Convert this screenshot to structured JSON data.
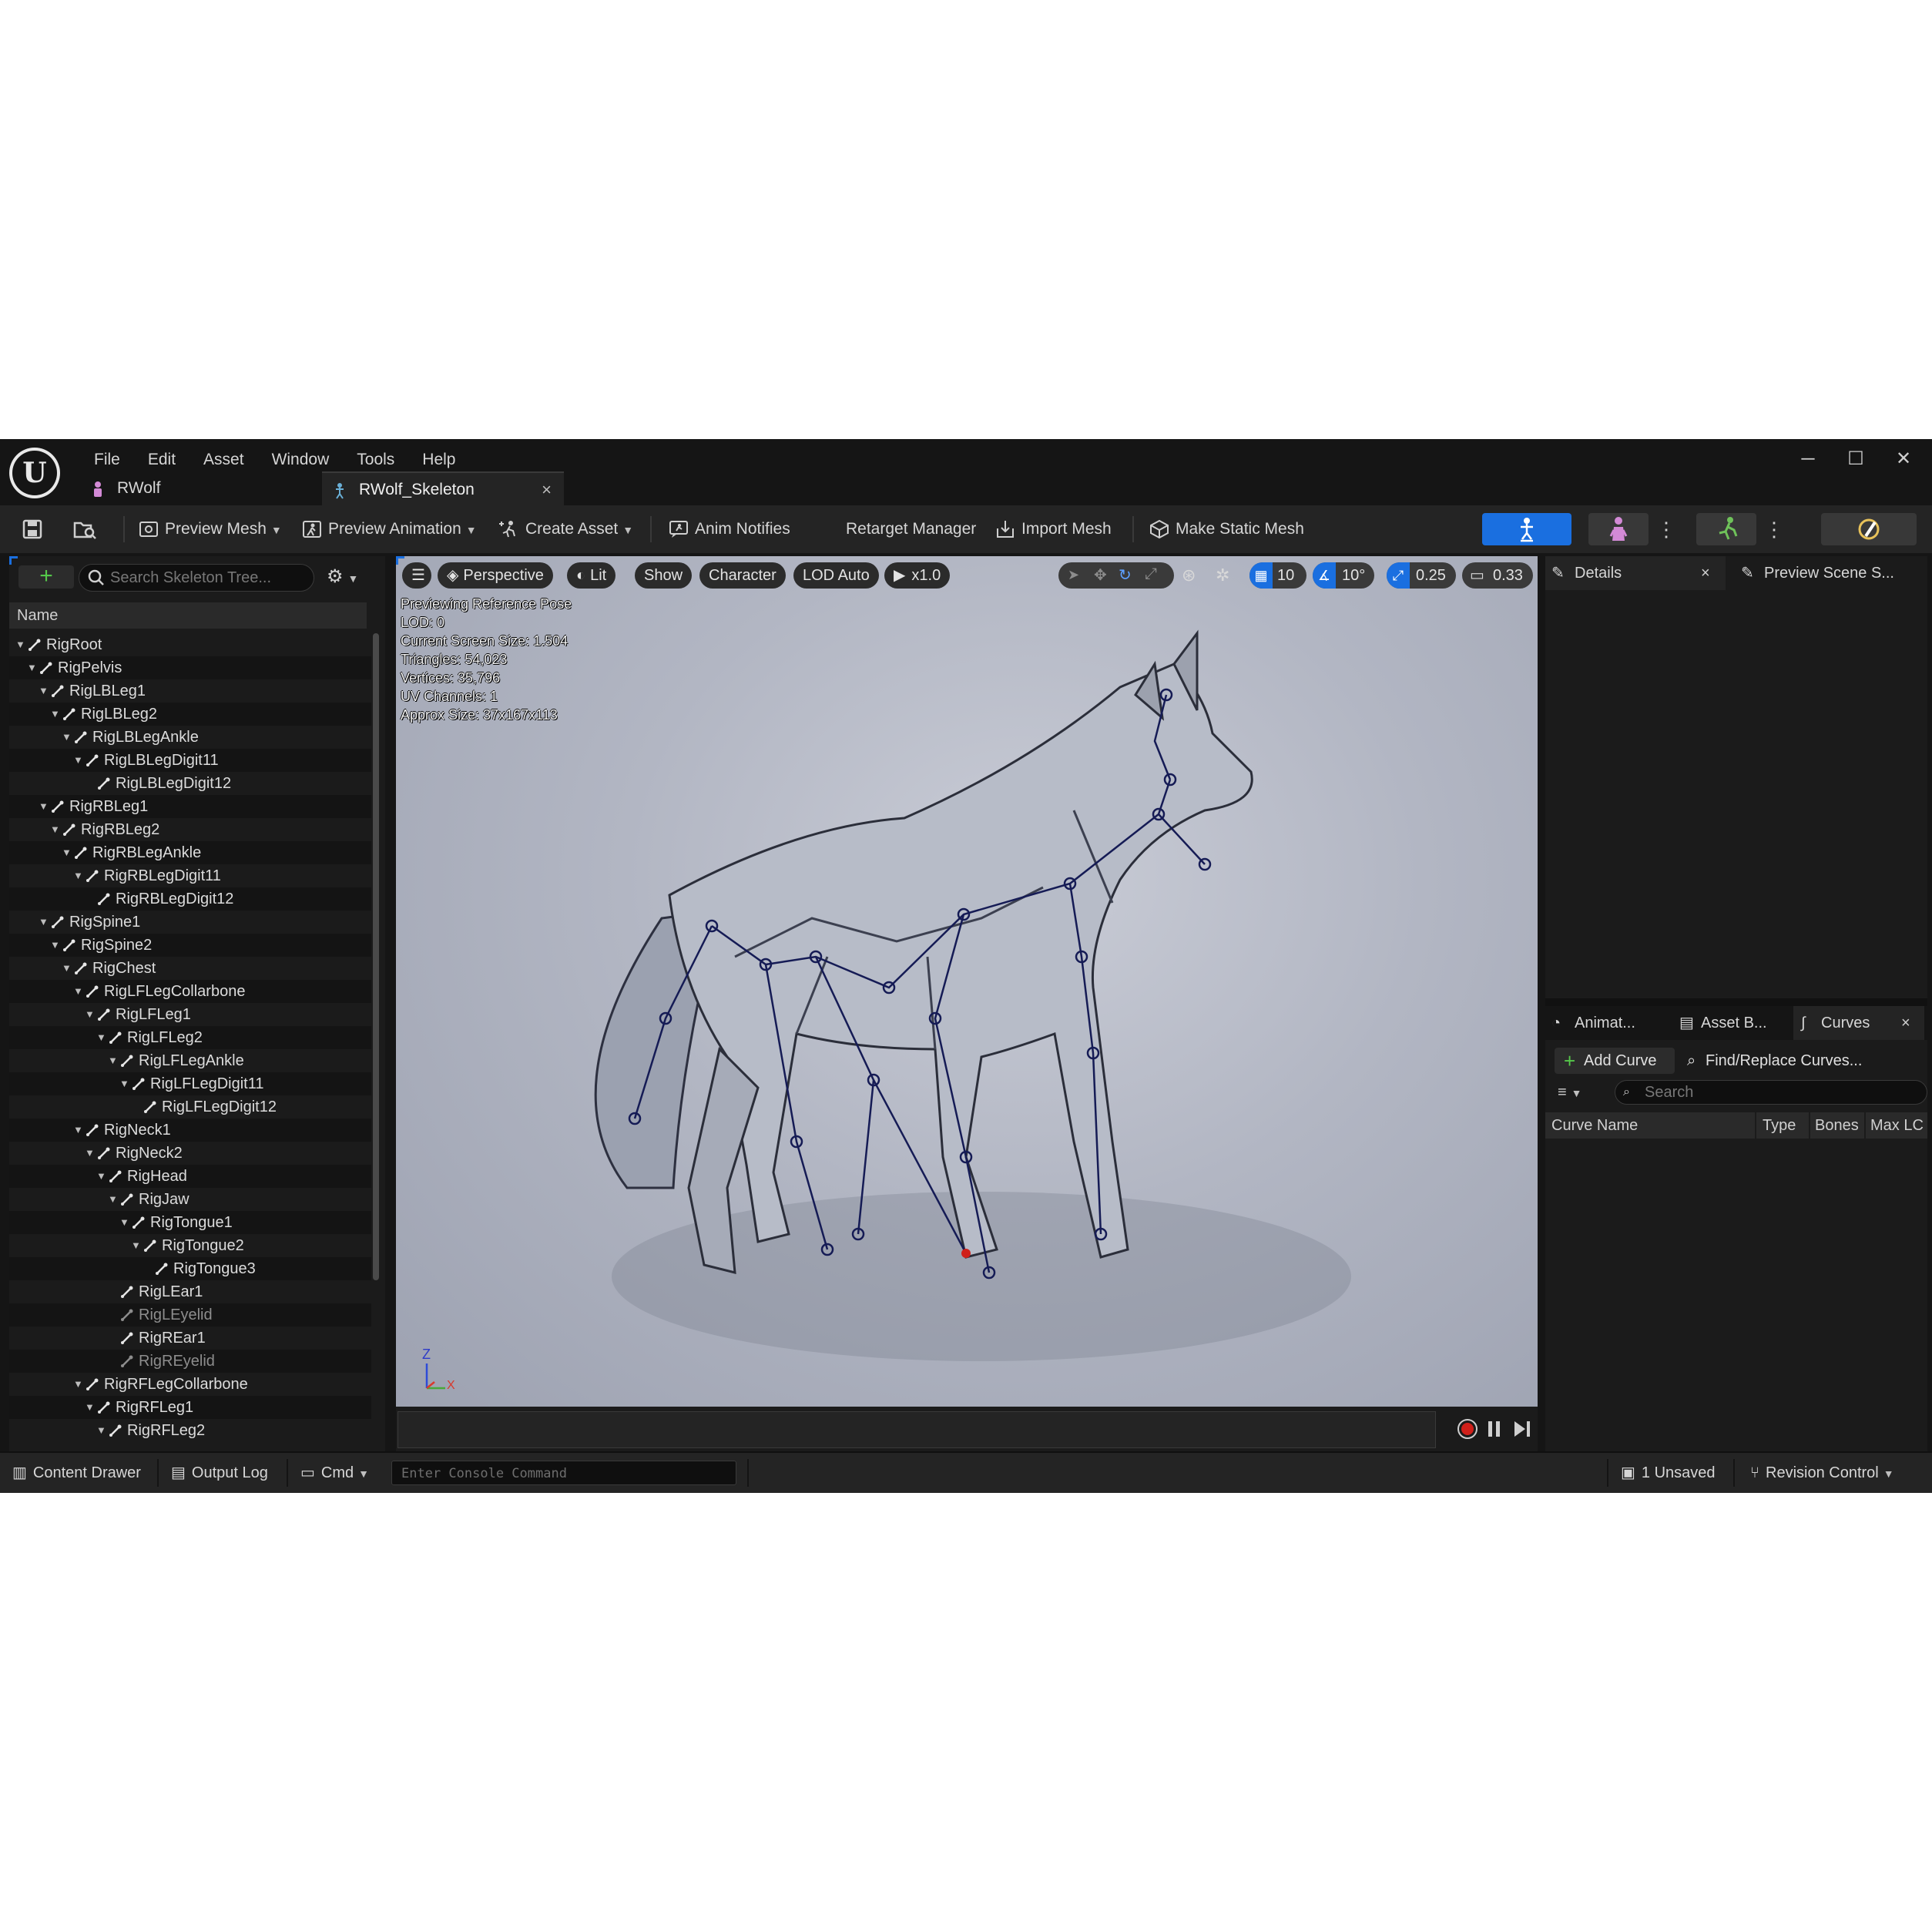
{
  "menu": [
    "File",
    "Edit",
    "Asset",
    "Window",
    "Tools",
    "Help"
  ],
  "tabs": [
    {
      "label": "RWolf"
    },
    {
      "label": "RWolf_Skeleton",
      "close": "×"
    }
  ],
  "window_controls": {
    "minimize": "─",
    "maximize": "☐",
    "close": "✕"
  },
  "toolbar": {
    "preview_mesh": "Preview Mesh",
    "preview_animation": "Preview Animation",
    "create_asset": "Create Asset",
    "anim_notifies": "Anim Notifies",
    "retarget_manager": "Retarget Manager",
    "import_mesh": "Import Mesh",
    "make_static_mesh": "Make Static Mesh"
  },
  "skeleton_tree": {
    "search_placeholder": "Search Skeleton Tree...",
    "column_header": "Name",
    "bones": [
      {
        "name": "RigRoot",
        "depth": 0,
        "expanded": true
      },
      {
        "name": "RigPelvis",
        "depth": 1,
        "expanded": true
      },
      {
        "name": "RigLBLeg1",
        "depth": 2,
        "expanded": true
      },
      {
        "name": "RigLBLeg2",
        "depth": 3,
        "expanded": true
      },
      {
        "name": "RigLBLegAnkle",
        "depth": 4,
        "expanded": true
      },
      {
        "name": "RigLBLegDigit11",
        "depth": 5,
        "expanded": true
      },
      {
        "name": "RigLBLegDigit12",
        "depth": 6,
        "expanded": false
      },
      {
        "name": "RigRBLeg1",
        "depth": 2,
        "expanded": true
      },
      {
        "name": "RigRBLeg2",
        "depth": 3,
        "expanded": true
      },
      {
        "name": "RigRBLegAnkle",
        "depth": 4,
        "expanded": true
      },
      {
        "name": "RigRBLegDigit11",
        "depth": 5,
        "expanded": true
      },
      {
        "name": "RigRBLegDigit12",
        "depth": 6,
        "expanded": false
      },
      {
        "name": "RigSpine1",
        "depth": 2,
        "expanded": true
      },
      {
        "name": "RigSpine2",
        "depth": 3,
        "expanded": true
      },
      {
        "name": "RigChest",
        "depth": 4,
        "expanded": true
      },
      {
        "name": "RigLFLegCollarbone",
        "depth": 5,
        "expanded": true
      },
      {
        "name": "RigLFLeg1",
        "depth": 6,
        "expanded": true
      },
      {
        "name": "RigLFLeg2",
        "depth": 7,
        "expanded": true
      },
      {
        "name": "RigLFLegAnkle",
        "depth": 8,
        "expanded": true
      },
      {
        "name": "RigLFLegDigit11",
        "depth": 9,
        "expanded": true
      },
      {
        "name": "RigLFLegDigit12",
        "depth": 10,
        "expanded": false
      },
      {
        "name": "RigNeck1",
        "depth": 5,
        "expanded": true
      },
      {
        "name": "RigNeck2",
        "depth": 6,
        "expanded": true
      },
      {
        "name": "RigHead",
        "depth": 7,
        "expanded": true
      },
      {
        "name": "RigJaw",
        "depth": 8,
        "expanded": true
      },
      {
        "name": "RigTongue1",
        "depth": 9,
        "expanded": true
      },
      {
        "name": "RigTongue2",
        "depth": 10,
        "expanded": true
      },
      {
        "name": "RigTongue3",
        "depth": 11,
        "expanded": false
      },
      {
        "name": "RigLEar1",
        "depth": 8,
        "expanded": false
      },
      {
        "name": "RigLEyelid",
        "depth": 8,
        "expanded": false,
        "dim": true
      },
      {
        "name": "RigREar1",
        "depth": 8,
        "expanded": false
      },
      {
        "name": "RigREyelid",
        "depth": 8,
        "expanded": false,
        "dim": true
      },
      {
        "name": "RigRFLegCollarbone",
        "depth": 5,
        "expanded": true
      },
      {
        "name": "RigRFLeg1",
        "depth": 6,
        "expanded": true
      },
      {
        "name": "RigRFLeg2",
        "depth": 7,
        "expanded": true
      }
    ]
  },
  "viewport": {
    "perspective": "Perspective",
    "lit": "Lit",
    "show": "Show",
    "character": "Character",
    "lod": "LOD Auto",
    "speed": "x1.0",
    "grid_snap": "10",
    "rotation_snap": "10°",
    "scale_snap": "0.25",
    "camera_speed": "0.33",
    "stats": [
      "Previewing Reference Pose",
      "LOD: 0",
      "Current Screen Size: 1.504",
      "Triangles: 54,023",
      "Vertices: 35,796",
      "UV Channels: 1",
      "Approx Size: 37x167x113"
    ],
    "axis_z": "Z",
    "axis_x": "X"
  },
  "details_panel": {
    "tab_details": "Details",
    "tab_preview_scene": "Preview Scene S...",
    "close": "×"
  },
  "curves_panel": {
    "tab_animations": "Animat...",
    "tab_asset_browser": "Asset B...",
    "tab_curves": "Curves",
    "close": "×",
    "add_curve": "Add Curve",
    "find_replace": "Find/Replace Curves...",
    "search_placeholder": "Search",
    "columns": [
      "Curve Name",
      "Type",
      "Bones",
      "Max LC"
    ]
  },
  "status_bar": {
    "content_drawer": "Content Drawer",
    "output_log": "Output Log",
    "cmd": "Cmd",
    "console_placeholder": "Enter Console Command",
    "unsaved": "1 Unsaved",
    "revision_control": "Revision Control"
  },
  "colors": {
    "accent": "#1a6fe0",
    "panel": "#1b1b1b",
    "add_green": "#55c84a",
    "record_red": "#d0201a"
  }
}
